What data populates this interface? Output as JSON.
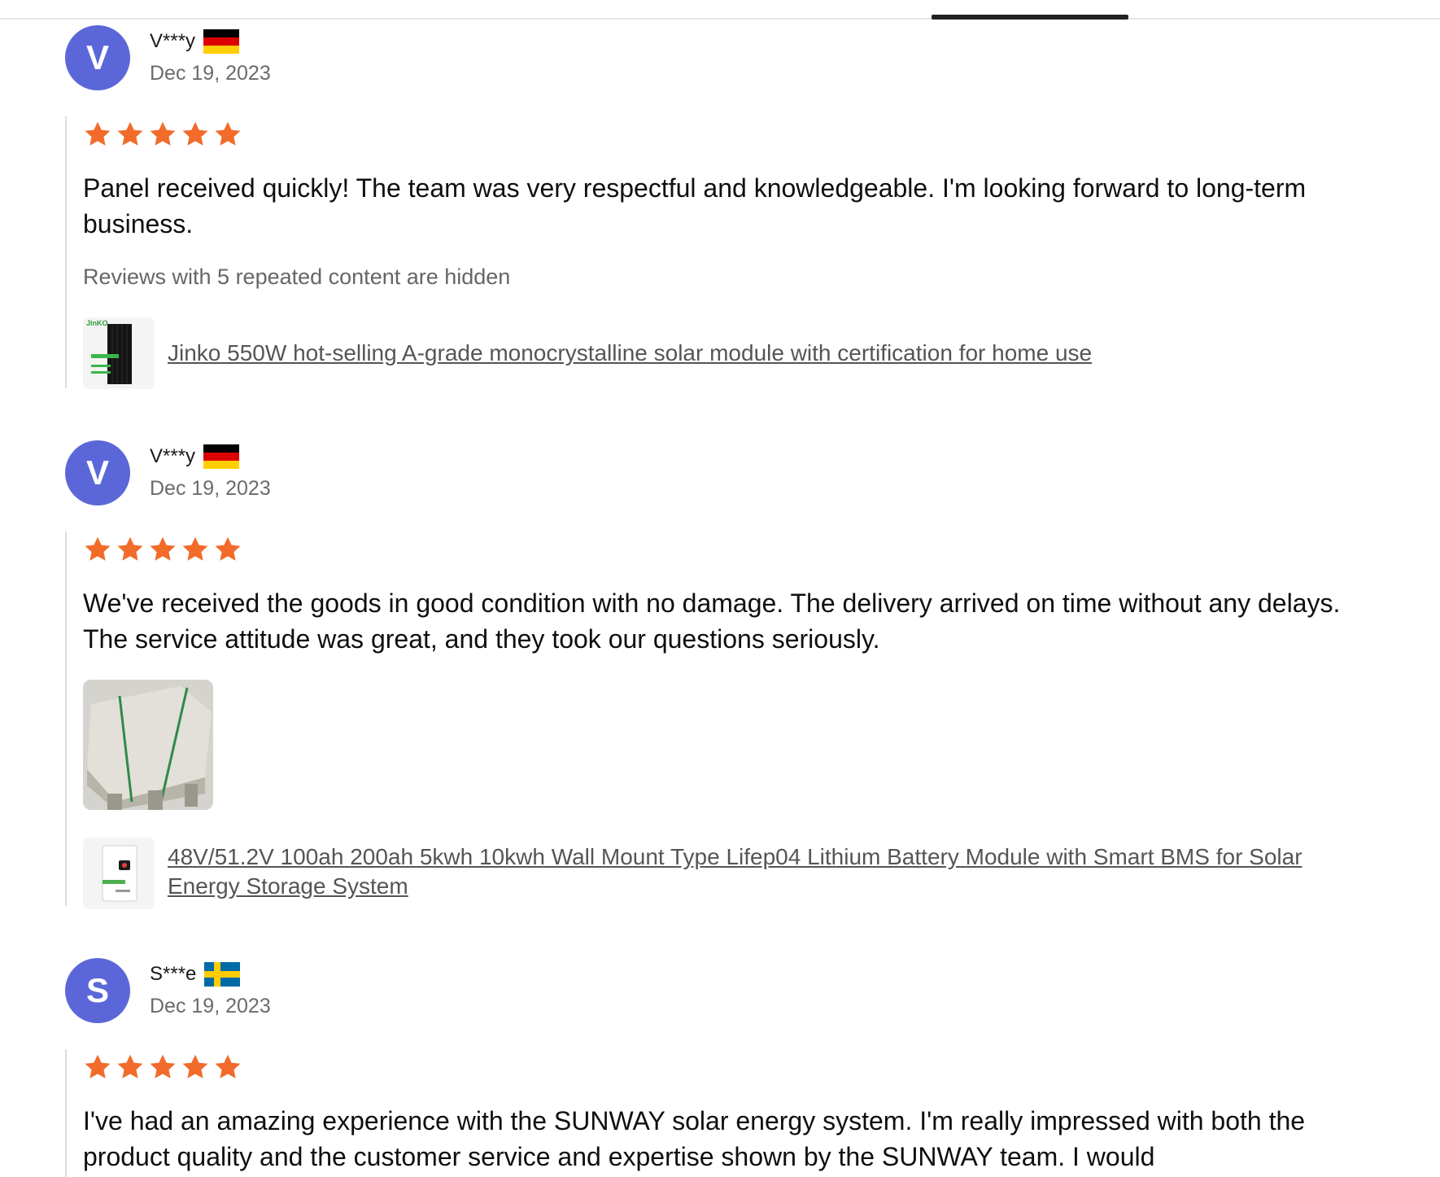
{
  "reviews": [
    {
      "avatar_letter": "V",
      "name": "V***y",
      "flag": "germany-flag",
      "date": "Dec 19, 2023",
      "rating": 5,
      "text": "Panel received quickly! The team was very respectful and knowledgeable. I'm looking forward to long-term business.",
      "hidden_note": "Reviews with 5 repeated content are hidden",
      "product_title": "Jinko 550W hot-selling A-grade monocrystalline solar module with certification for home use",
      "product_thumb_text": "JinKO"
    },
    {
      "avatar_letter": "V",
      "name": "V***y",
      "flag": "germany-flag",
      "date": "Dec 19, 2023",
      "rating": 5,
      "text": "We've received the goods in good condition with no damage. The delivery arrived on time without any delays. The service attitude was great, and they took our questions seriously.",
      "product_title": "48V/51.2V 100ah 200ah 5kwh 10kwh Wall Mount Type Lifep04 Lithium Battery Module with Smart BMS for Solar Energy Storage System"
    },
    {
      "avatar_letter": "S",
      "name": "S***e",
      "flag": "sweden-flag",
      "date": "Dec 19, 2023",
      "rating": 5,
      "text": "I've had an amazing experience with the SUNWAY solar energy system. I'm really impressed with both the product quality and the customer service and expertise shown by the SUNWAY team. I would"
    }
  ],
  "colors": {
    "avatar_bg": "#5b67d8",
    "star": "#f26b2a",
    "link": "#555555",
    "muted": "#6b6b6b"
  }
}
